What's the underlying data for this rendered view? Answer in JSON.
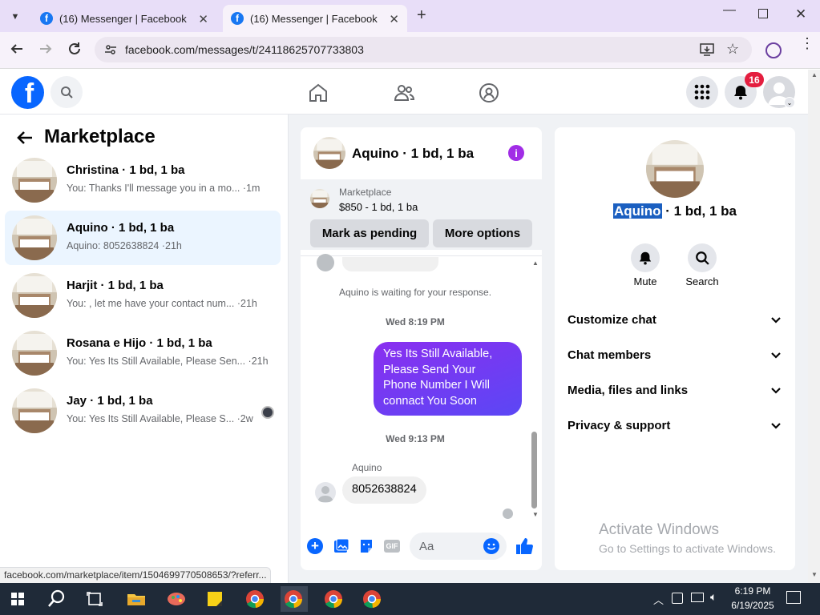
{
  "browser": {
    "tabs": [
      {
        "title": "(16) Messenger | Facebook",
        "active": false
      },
      {
        "title": "(16) Messenger | Facebook",
        "active": true
      }
    ],
    "url": "facebook.com/messages/t/24118625707733803"
  },
  "facebook": {
    "notification_count": "16"
  },
  "sidebar": {
    "title": "Marketplace",
    "conversations": [
      {
        "name": "Christina · 1 bd, 1 ba",
        "preview": "You: Thanks I'll message you in a mo... ·1m"
      },
      {
        "name": "Aquino · 1 bd, 1 ba",
        "preview": "Aquino: 8052638824 ·21h",
        "selected": true
      },
      {
        "name": "Harjit · 1 bd, 1 ba",
        "preview": "You: , let me have your contact num... ·21h"
      },
      {
        "name": "Rosana e Hijo · 1 bd, 1 ba",
        "preview": "You: Yes Its Still Available, Please Sen... ·21h"
      },
      {
        "name": "Jay · 1 bd, 1 ba",
        "preview": "You: Yes Its Still Available, Please S... ·2w"
      }
    ]
  },
  "chat": {
    "title": "Aquino · 1 bd, 1 ba",
    "listing_label": "Marketplace",
    "listing_detail": "$850 - 1 bd, 1 ba",
    "mark_pending_label": "Mark as pending",
    "more_options_label": "More options",
    "waiting_text": "Aquino is waiting for your response.",
    "time1": "Wed 8:19 PM",
    "sent_message": "Yes Its Still Available, Please Send Your Phone Number I Will connact You Soon",
    "time2": "Wed 9:13 PM",
    "sender_name": "Aquino",
    "received_message": "8052638824",
    "input_placeholder": "Aa",
    "accent_color": "#0866ff",
    "bubble_color": "#7b2ff7"
  },
  "info_panel": {
    "name_highlight": "Aquino",
    "name_rest": " · 1 bd, 1 ba",
    "mute_label": "Mute",
    "search_label": "Search",
    "sections": [
      "Customize chat",
      "Chat members",
      "Media, files and links",
      "Privacy & support"
    ]
  },
  "watermark": {
    "line1": "Activate Windows",
    "line2": "Go to Settings to activate Windows."
  },
  "status_url": "facebook.com/marketplace/item/1504699770508653/?referr...",
  "taskbar": {
    "time": "6:19 PM",
    "date": "6/19/2025"
  }
}
